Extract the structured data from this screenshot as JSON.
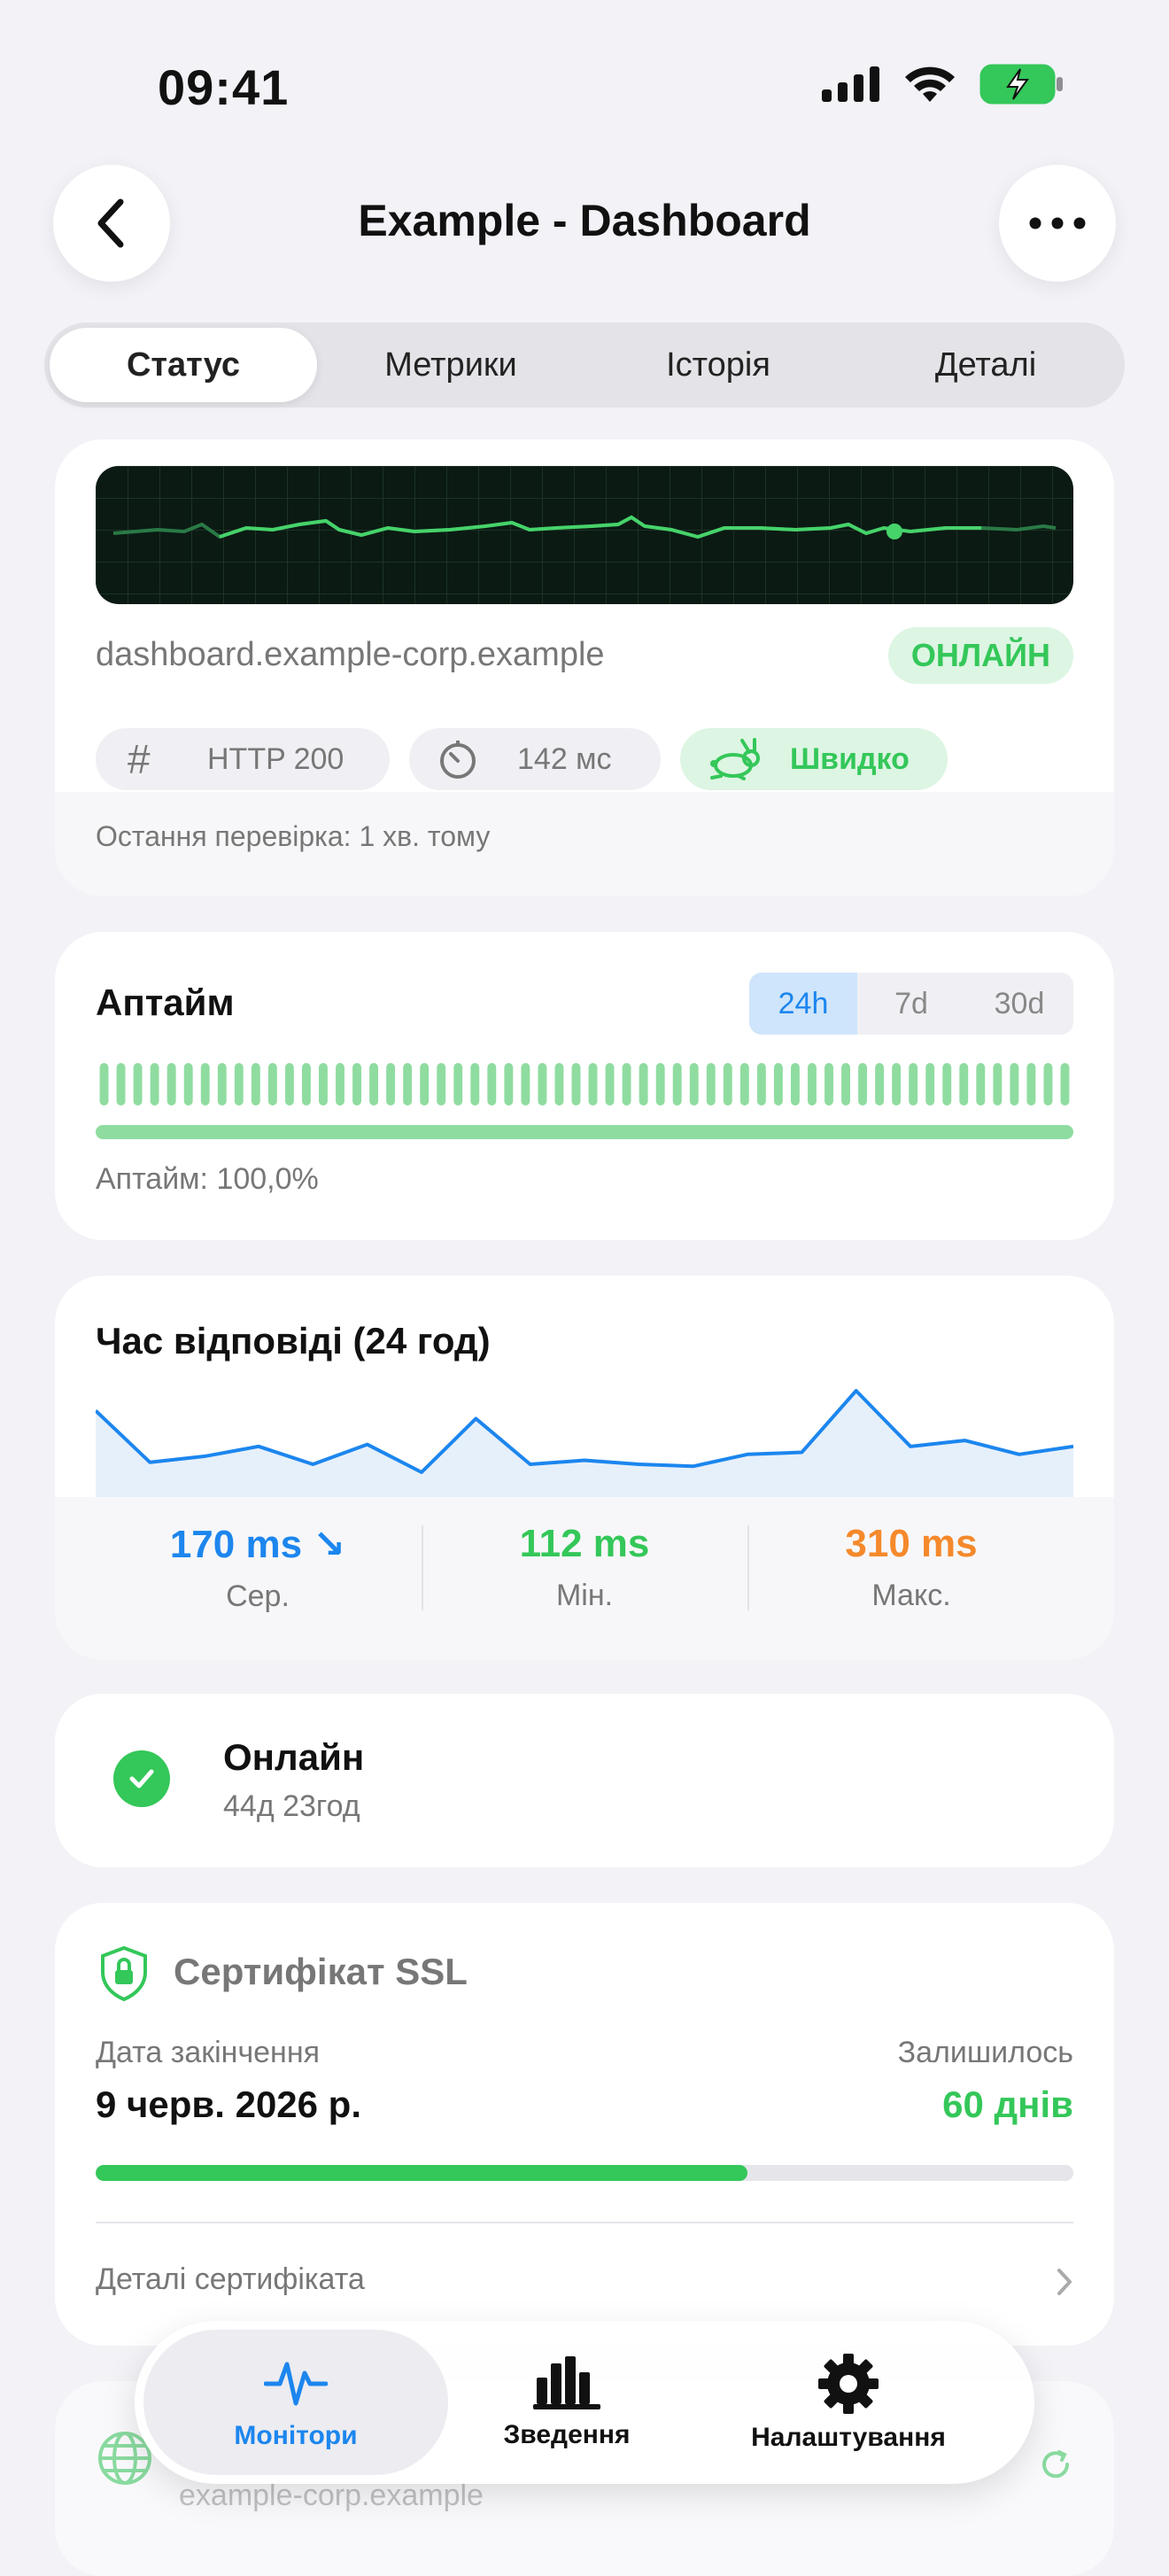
{
  "status_bar": {
    "time": "09:41"
  },
  "nav": {
    "title": "Example - Dashboard"
  },
  "tabs": [
    {
      "label": "Статус",
      "active": true
    },
    {
      "label": "Метрики"
    },
    {
      "label": "Історія"
    },
    {
      "label": "Деталі"
    }
  ],
  "status_card": {
    "host": "dashboard.example-corp.example",
    "status_badge": "ОНЛАЙН",
    "http_code": "HTTP 200",
    "latency": "142 мс",
    "speed": "Швидко",
    "last_check": "Остання перевірка: 1 хв. тому"
  },
  "uptime_card": {
    "title": "Аптайм",
    "ranges": [
      "24h",
      "7d",
      "30d"
    ],
    "active_range": "24h",
    "uptime_text": "Аптайм: 100,0%",
    "uptime_fraction": 1.0,
    "check_count": 58
  },
  "response_card": {
    "title": "Час відповіді (24 год)",
    "avg_value": "170 ms",
    "avg_arrow": "↘",
    "avg_label": "Сер.",
    "min_value": "112 ms",
    "min_label": "Мін.",
    "max_value": "310 ms",
    "max_label": "Макс.",
    "sparkline_ms": [
      260,
      130,
      145,
      170,
      125,
      175,
      105,
      240,
      125,
      135,
      125,
      120,
      150,
      155,
      310,
      170,
      185,
      150,
      170
    ]
  },
  "online_card": {
    "title": "Онлайн",
    "duration": "44д 23год"
  },
  "ssl_card": {
    "title": "Сертифікат SSL",
    "expiry_label": "Дата закінчення",
    "expiry_date": "9 черв. 2026 р.",
    "remaining_label": "Залишилось",
    "remaining": "60 днів",
    "progress": 0.667,
    "details_link": "Деталі сертифіката"
  },
  "next_card": {
    "subtitle": "example-corp.example"
  },
  "tabbar": [
    {
      "label": "Монітори",
      "icon": "heartbeat-icon",
      "active": true
    },
    {
      "label": "Зведення",
      "icon": "bar-chart-icon"
    },
    {
      "label": "Налаштування",
      "icon": "gear-icon"
    }
  ],
  "colors": {
    "accent": "#1c86ee",
    "green": "#34c759",
    "orange": "#f5892b"
  }
}
